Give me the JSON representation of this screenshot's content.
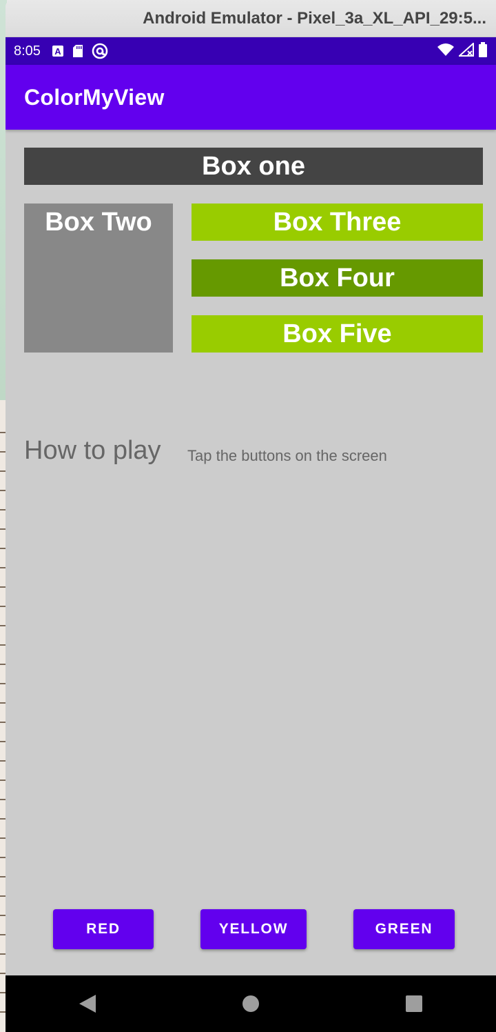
{
  "window": {
    "title": "Android Emulator - Pixel_3a_XL_API_29:5..."
  },
  "status_bar": {
    "time": "8:05",
    "left_icons": [
      "text-a-icon",
      "sd-card-icon",
      "at-icon"
    ],
    "right_icons": [
      "wifi-icon",
      "signal-icon",
      "battery-icon"
    ]
  },
  "app_bar": {
    "title": "ColorMyView",
    "color": "#6200ee"
  },
  "boxes": {
    "one": {
      "label": "Box one",
      "color": "#444444"
    },
    "two": {
      "label": "Box Two",
      "color": "#888888"
    },
    "three": {
      "label": "Box Three",
      "color": "#99cc00"
    },
    "four": {
      "label": "Box Four",
      "color": "#669900"
    },
    "five": {
      "label": "Box Five",
      "color": "#99cc00"
    }
  },
  "how_to_play": {
    "title": "How to play",
    "text": "Tap the buttons on the screen"
  },
  "buttons": {
    "red": "RED",
    "yellow": "YELLOW",
    "green": "GREEN",
    "color": "#6200ee"
  },
  "nav_bar": {
    "icons": [
      "back-icon",
      "home-icon",
      "recents-icon"
    ]
  },
  "colors": {
    "status_bar": "#3700b3",
    "screen_background": "#cccccc"
  }
}
